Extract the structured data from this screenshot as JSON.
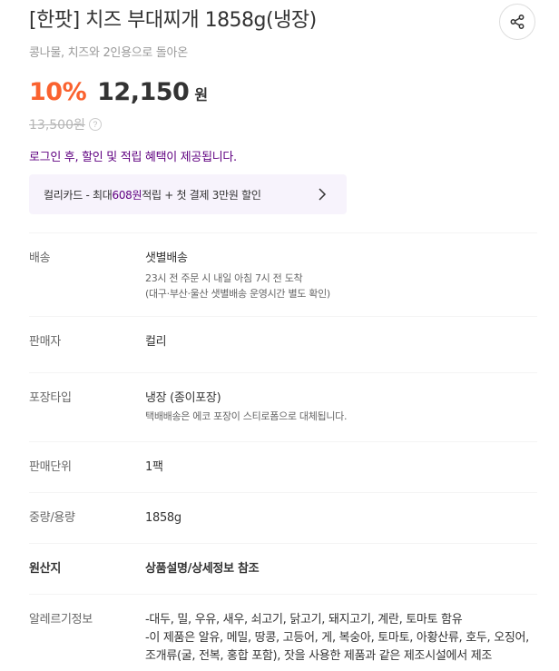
{
  "product": {
    "title": "[한팟] 치즈 부대찌개 1858g(냉장)",
    "subtitle": "콩나물, 치즈와 2인용으로 돌아온",
    "discount": "10%",
    "price": "12,150",
    "currency": "원",
    "original_price": "13,500원",
    "help_glyph": "?"
  },
  "login_note": "로그인 후, 할인 및 적립 혜택이 제공됩니다.",
  "card_banner": {
    "prefix": "컬리카드 - 최대 ",
    "highlight": "608원",
    "suffix": " 적립 + 첫 결제 3만원 할인"
  },
  "info": {
    "delivery": {
      "label": "배송",
      "value": "샛별배송",
      "sub1": "23시 전 주문 시 내일 아침 7시 전 도착",
      "sub2": "(대구·부산·울산 샛별배송 운영시간 별도 확인)"
    },
    "seller": {
      "label": "판매자",
      "value": "컬리"
    },
    "packaging": {
      "label": "포장타입",
      "value": "냉장 (종이포장)",
      "sub1": "택배배송은 에코 포장이 스티로폼으로 대체됩니다."
    },
    "unit": {
      "label": "판매단위",
      "value": "1팩"
    },
    "weight": {
      "label": "중량/용량",
      "value": "1858g"
    },
    "origin": {
      "label": "원산지",
      "value": "상품설명/상세정보 참조"
    },
    "allergy": {
      "label": "알레르기정보",
      "line1": "-대두, 밀, 우유, 새우, 쇠고기, 닭고기, 돼지고기, 계란, 토마토 함유",
      "line2": "-이 제품은 알유, 메밀, 땅콩, 고등어, 게, 복숭아, 토마토, 아황산류, 호두, 오징어,",
      "line3": "조개류(굴, 전복, 홍합 포함), 잣을 사용한 제품과 같은 제조시설에서 제조"
    }
  },
  "icons": {
    "share": "share-icon",
    "chevron": "chevron-right-icon"
  },
  "colors": {
    "discount": "#fa622f",
    "brand_purple": "#5f0080",
    "banner_bg": "#f7f3fc"
  }
}
